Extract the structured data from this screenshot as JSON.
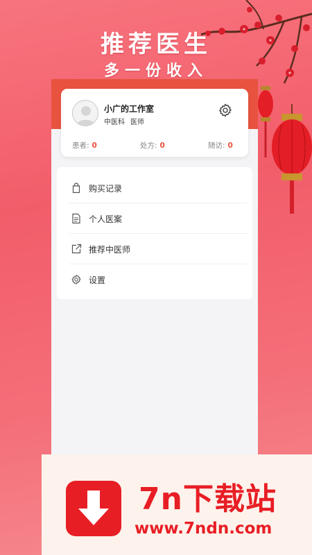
{
  "promo": {
    "headline": "推荐医生",
    "subheadline": "多一份收入"
  },
  "profile": {
    "name": "小广的工作室",
    "department": "中医科",
    "role": "医师"
  },
  "stats": [
    {
      "label": "患者:",
      "value": "0"
    },
    {
      "label": "处方:",
      "value": "0"
    },
    {
      "label": "随访:",
      "value": "0"
    }
  ],
  "menu": [
    {
      "label": "购买记录",
      "icon": "bag-icon"
    },
    {
      "label": "个人医案",
      "icon": "document-icon"
    },
    {
      "label": "推荐中医师",
      "icon": "share-icon"
    },
    {
      "label": "设置",
      "icon": "gear-icon"
    }
  ],
  "watermark": {
    "title": "7n下载站",
    "url": "www.7ndn.com"
  },
  "colors": {
    "accent": "#e8533f",
    "background": "#f25d6a",
    "watermark_red": "#e81e25"
  }
}
